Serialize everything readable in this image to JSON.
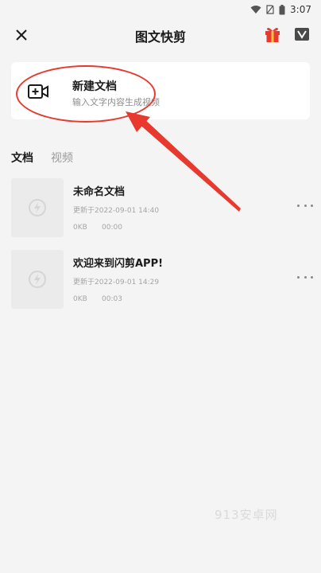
{
  "status_bar": {
    "time": "3:07"
  },
  "header": {
    "title": "图文快剪"
  },
  "new_document": {
    "title": "新建文档",
    "subtitle": "输入文字内容生成视频"
  },
  "tabs": [
    {
      "label": "文档",
      "active": true
    },
    {
      "label": "视频",
      "active": false
    }
  ],
  "documents": [
    {
      "name": "未命名文档",
      "updated": "更新于2022-09-01 14:40",
      "size": "0KB",
      "duration": "00:00"
    },
    {
      "name": "欢迎来到闪剪APP!",
      "updated": "更新于2022-09-01 14:29",
      "size": "0KB",
      "duration": "00:03"
    }
  ],
  "watermark": "913安卓网",
  "colors": {
    "annotation": "#e8392e",
    "gift": "#e8392e",
    "background": "#f4f4f4"
  }
}
